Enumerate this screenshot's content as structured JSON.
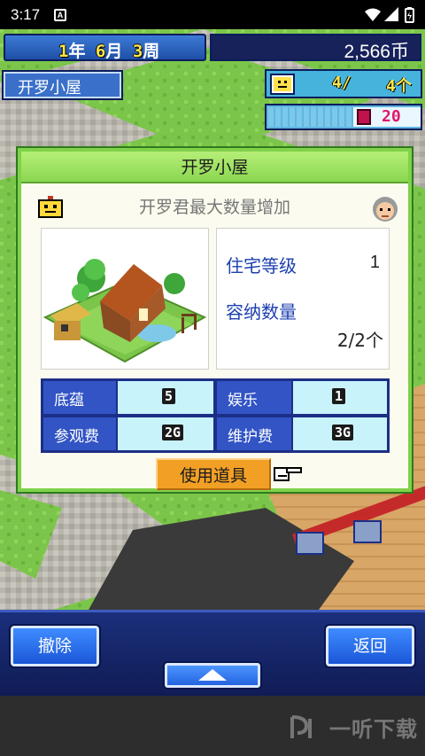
{
  "status_bar": {
    "time": "3:17",
    "notification_icon": "A"
  },
  "hud": {
    "date": {
      "year": "1",
      "year_unit": "年",
      "month": "6",
      "month_unit": "月",
      "week": "3",
      "week_unit": "周"
    },
    "money": "2,566币",
    "location": "开罗小屋",
    "visitors": "4/",
    "capacity": "4个",
    "tickets": "20"
  },
  "dialog": {
    "title": "开罗小屋",
    "subtitle": "开罗君最大数量增加",
    "housing_level_label": "住宅等级",
    "housing_level_value": "1",
    "capacity_label": "容纳数量",
    "capacity_value": "2/2个",
    "stats": [
      {
        "label": "底蕴",
        "value": "5"
      },
      {
        "label": "娱乐",
        "value": "1"
      },
      {
        "label": "参观费",
        "value": "2G"
      },
      {
        "label": "维护费",
        "value": "3G"
      }
    ],
    "use_item_label": "使用道具"
  },
  "bottom": {
    "remove_label": "撤除",
    "back_label": "返回"
  },
  "watermark": {
    "text": "一听下载"
  },
  "colors": {
    "dialog_border": "#7fd24a",
    "stat_label_bg": "#3254c4",
    "stat_value_bg": "#c9f3fb",
    "use_button": "#f2a025",
    "nav_button": "#2a6ff0"
  }
}
